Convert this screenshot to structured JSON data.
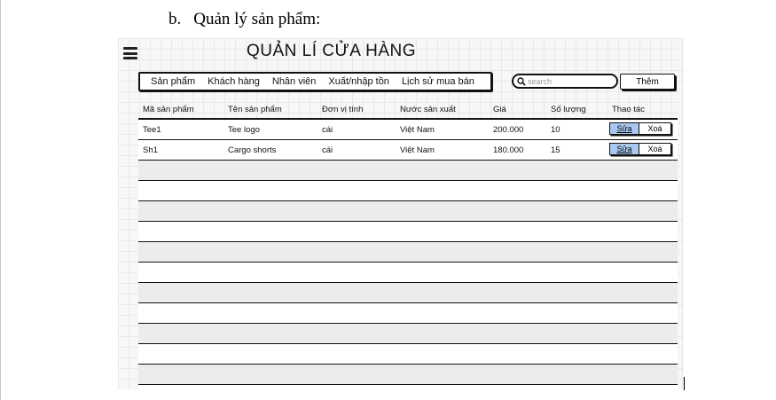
{
  "doc": {
    "heading_marker": "b.",
    "heading_text": "Quản lý sản phẩm:"
  },
  "app": {
    "title": "QUẢN LÍ CỬA HÀNG"
  },
  "nav": {
    "items": [
      "Sản phẩm",
      "Khách hàng",
      "Nhân viên",
      "Xuất/nhập tồn",
      "Lịch sử mua bán"
    ]
  },
  "search": {
    "placeholder": "search"
  },
  "toolbar": {
    "add_label": "Thêm"
  },
  "table": {
    "headers": [
      "Mã sản phẩm",
      "Tên sản phẩm",
      "Đơn vị tính",
      "Nước sản xuất",
      "Giá",
      "Số lượng",
      "Thao tác"
    ],
    "rows": [
      {
        "code": "Tee1",
        "name": "Tee logo",
        "unit": "cái",
        "country": "Việt Nam",
        "price": "200.000",
        "qty": "10",
        "edit": "Sửa",
        "delete": "Xoá"
      },
      {
        "code": "Sh1",
        "name": "Cargo shorts",
        "unit": "cái",
        "country": "Việt Nam",
        "price": "180.000",
        "qty": "15",
        "edit": "Sửa",
        "delete": "Xoá"
      }
    ]
  },
  "colors": {
    "edit_button": "#a9c8f0",
    "alt_row": "#ececec",
    "grid_background": "#f7f7f7"
  }
}
